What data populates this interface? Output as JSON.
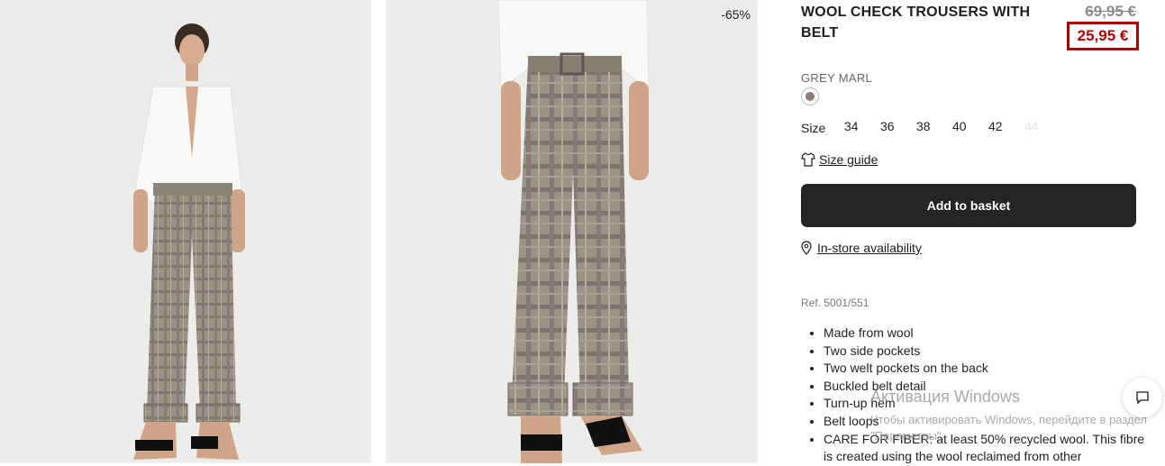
{
  "product": {
    "title": "WOOL CHECK TROUSERS WITH BELT",
    "old_price": "69,95 €",
    "new_price": "25,95 €",
    "discount": "-65%",
    "color": "GREY MARL",
    "size_label": "Size",
    "sizes": [
      {
        "label": "34",
        "available": true
      },
      {
        "label": "36",
        "available": true
      },
      {
        "label": "38",
        "available": true
      },
      {
        "label": "40",
        "available": true
      },
      {
        "label": "42",
        "available": true
      },
      {
        "label": "44",
        "available": false
      }
    ],
    "size_guide": "Size guide",
    "add_to_basket": "Add to basket",
    "in_store": "In-store availability",
    "ref": "Ref. 5001/551",
    "features": [
      "Made from wool",
      "Two side pockets",
      "Two welt pockets on the back",
      "Buckled belt detail",
      "Turn-up hem",
      "Belt loops",
      "CARE FOR FIBER: at least 50% recycled wool. This fibre is created using the wool reclaimed from other"
    ]
  },
  "watermark": {
    "line1": "Активация Windows",
    "line2": "Чтобы активировать Windows, перейдите в раздел \"Параметры\"."
  },
  "icons": {
    "swatch": "color-swatch-icon",
    "size_guide": "tshirt-icon",
    "store": "location-pin-icon",
    "chat": "chat-icon"
  },
  "colors": {
    "sale_red": "#b00000",
    "button_dark": "#252525",
    "photo_bg": "#ececeb"
  }
}
